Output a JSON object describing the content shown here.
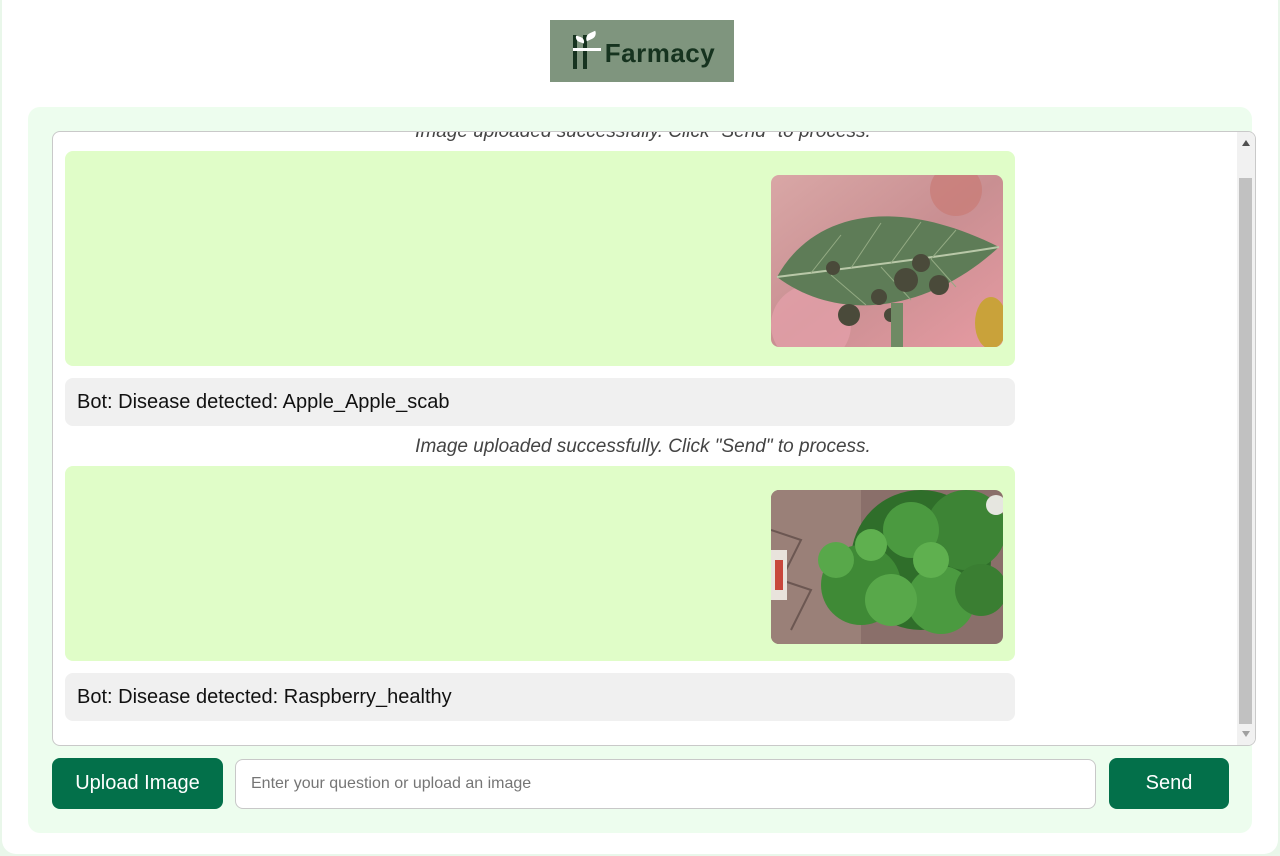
{
  "logo": {
    "text": "Farmacy"
  },
  "messages": [
    {
      "type": "status",
      "text": "Image uploaded successfully. Click \"Send\" to process."
    },
    {
      "type": "image",
      "image": "apple-leaf-with-scab-spots"
    },
    {
      "type": "bot",
      "text": "Bot: Disease detected: Apple_Apple_scab"
    },
    {
      "type": "status",
      "text": "Image uploaded successfully. Click \"Send\" to process."
    },
    {
      "type": "image",
      "image": "raspberry-plant-leaves"
    },
    {
      "type": "bot",
      "text": "Bot: Disease detected: Raspberry_healthy"
    }
  ],
  "controls": {
    "upload_label": "Upload Image",
    "input_placeholder": "Enter your question or upload an image",
    "input_value": "",
    "send_label": "Send"
  },
  "colors": {
    "primary_button": "#03704a",
    "image_message_bg": "#e0fdc8",
    "bot_message_bg": "#f0f0f0",
    "panel_bg": "#edfdee"
  }
}
